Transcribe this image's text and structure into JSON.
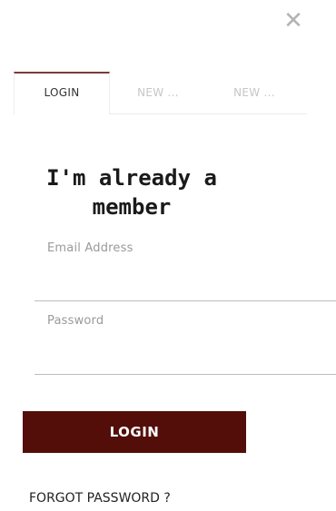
{
  "dialog": {
    "close_glyph": "✕"
  },
  "tabs": [
    {
      "label": "LOGIN",
      "active": true
    },
    {
      "label": "NEW ..."
    },
    {
      "label": "NEW ..."
    }
  ],
  "heading": {
    "line1": "I'm already a",
    "line2": "member"
  },
  "form": {
    "email_label": "Email Address",
    "email_value": "",
    "password_label": "Password",
    "password_value": "",
    "submit_label": "LOGIN",
    "forgot_label": "FORGOT PASSWORD ?"
  },
  "colors": {
    "accent": "#530e0a",
    "active_tab_border": "#7a3b35",
    "inactive_tab_text": "#c6c6c6",
    "close_icon": "#b3b3b3"
  }
}
